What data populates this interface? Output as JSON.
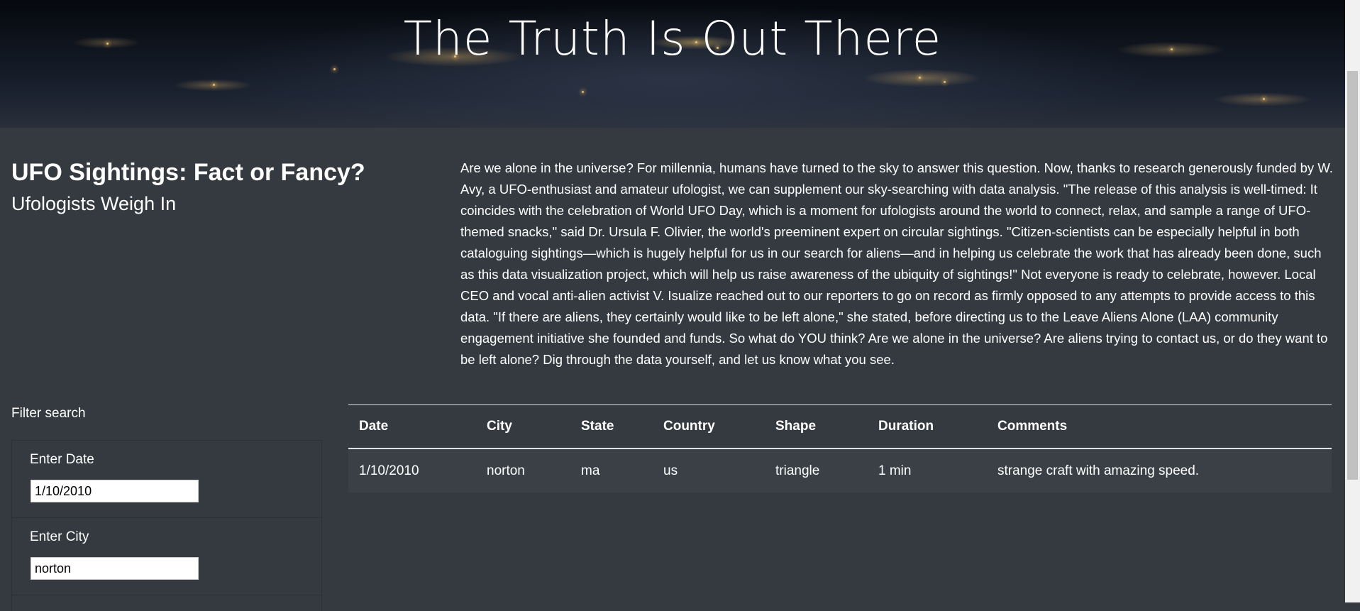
{
  "hero": {
    "title": "The Truth Is Out There"
  },
  "header": {
    "title": "UFO Sightings: Fact or Fancy?",
    "subtitle": "Ufologists Weigh In"
  },
  "article": {
    "text": "Are we alone in the universe? For millennia, humans have turned to the sky to answer this question. Now, thanks to research generously funded by W. Avy, a UFO-enthusiast and amateur ufologist, we can supplement our sky-searching with data analysis. \"The release of this analysis is well-timed: It coincides with the celebration of World UFO Day, which is a moment for ufologists around the world to connect, relax, and sample a range of UFO-themed snacks,\" said Dr. Ursula F. Olivier, the world's preeminent expert on circular sightings. \"Citizen-scientists can be especially helpful in both cataloguing sightings—which is hugely helpful for us in our search for aliens—and in helping us celebrate the work that has already been done, such as this data visualization project, which will help us raise awareness of the ubiquity of sightings!\" Not everyone is ready to celebrate, however. Local CEO and vocal anti-alien activist V. Isualize reached out to our reporters to go on record as firmly opposed to any attempts to provide access to this data. \"If there are aliens, they certainly would like to be left alone,\" she stated, before directing us to the Leave Aliens Alone (LAA) community engagement initiative she founded and funds. So what do YOU think? Are we alone in the universe? Are aliens trying to contact us, or do they want to be left alone? Dig through the data yourself, and let us know what you see."
  },
  "filter": {
    "heading": "Filter search",
    "items": [
      {
        "label": "Enter Date",
        "value": "1/10/2010"
      },
      {
        "label": "Enter City",
        "value": "norton"
      }
    ]
  },
  "table": {
    "columns": [
      "Date",
      "City",
      "State",
      "Country",
      "Shape",
      "Duration",
      "Comments"
    ],
    "rows": [
      [
        "1/10/2010",
        "norton",
        "ma",
        "us",
        "triangle",
        "1 min",
        "strange craft with amazing speed."
      ]
    ]
  },
  "colors": {
    "background": "#343a40",
    "text": "#ffffff",
    "row_background": "#3a4046"
  }
}
